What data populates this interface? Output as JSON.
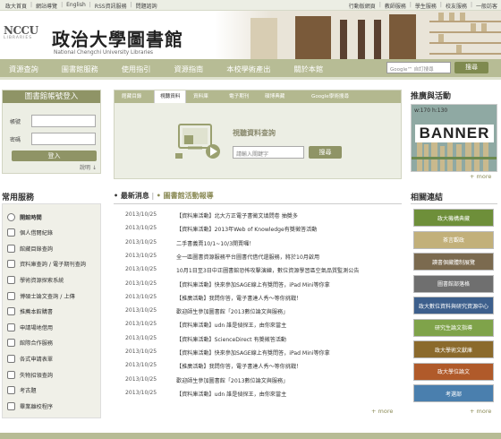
{
  "topbar": {
    "left": [
      "政大首頁",
      "網站導覽",
      "English",
      "RSS資訊服務",
      "問題諮詢"
    ],
    "right": [
      "行動版網頁",
      "教師服務",
      "學生服務",
      "校友服務",
      "一般訪客"
    ]
  },
  "header": {
    "logo_text": "NCCU",
    "logo_sub": "LIBRARIES",
    "title_zh": "政治大學圖書館",
    "title_en": "National Chengchi University Libraries"
  },
  "nav": {
    "items": [
      "資源查詢",
      "圖書館服務",
      "使用指引",
      "資源指南",
      "本校學術產出",
      "關於本館"
    ],
    "search_placeholder": "Google™ 自訂搜尋",
    "search_button": "搜尋"
  },
  "login": {
    "title": "圖書館帳號登入",
    "account_label": "帳號",
    "password_label": "密碼",
    "submit_label": "登入",
    "help_label": "說明"
  },
  "services": {
    "title": "常用服務",
    "items": [
      "開館時間",
      "個人借閱紀錄",
      "館藏目錄查詢",
      "資料庫查詢 / 電子期刊查詢",
      "學術資源探索系統",
      "博碩士論文查詢 / 上傳",
      "推薦本館購書",
      "申請場地借用",
      "館際合作服務",
      "各式申請表單",
      "失物招領查詢",
      "考古題",
      "畢業離校程序"
    ]
  },
  "search_tabs": {
    "tabs": [
      "館藏目錄",
      "視聽資料",
      "資料庫",
      "電子期刊",
      "碩博典藏",
      "Google學術搜尋"
    ],
    "active_index": 1,
    "panel_title": "視聽資料查詢",
    "input_placeholder": "請輸入關鍵字",
    "button_label": "搜尋"
  },
  "news": {
    "tab_latest": "最新消息",
    "tab_events": "圖書館活動報導",
    "items": [
      {
        "date": "2013/10/25",
        "title": "【資料庫活動】北大方正電子書徵文填問卷 抽獎多"
      },
      {
        "date": "2013/10/25",
        "title": "【資料庫活動】2013年Web of Knowledge有獎徵答活動"
      },
      {
        "date": "2013/10/25",
        "title": "二手書義賣10/1~10/3開賣囉！"
      },
      {
        "date": "2013/10/25",
        "title": "全一區圖書資源服務平台圖書代借代還服務，將於10月啟用"
      },
      {
        "date": "2013/10/25",
        "title": "10月1日至3日中正圖書館恐怖攻擊演練，數位資源學習區空氣品質監測公告"
      },
      {
        "date": "2013/10/25",
        "title": "【資料庫活動】快來參加SAGE線上有獎問答，iPad Mini等你拿"
      },
      {
        "date": "2013/10/25",
        "title": "【推廣活動】我問你答，電子書達人秀～等你挑戰！"
      },
      {
        "date": "2013/10/25",
        "title": "歡迎師生參加圖書館「2013數位論文與服務」"
      },
      {
        "date": "2013/10/25",
        "title": "【資料庫活動】udn 誰是偵探王，由你來當主"
      },
      {
        "date": "2013/10/25",
        "title": "【資料庫活動】ScienceDirect 有獎徵答活動"
      },
      {
        "date": "2013/10/25",
        "title": "【資料庫活動】快來參加SAGE線上有獎問答，iPad Mini等你拿"
      },
      {
        "date": "2013/10/25",
        "title": "【推廣活動】我問你答，電子書達人秀～等你挑戰！"
      },
      {
        "date": "2013/10/25",
        "title": "歡迎師生參加圖書館「2013數位論文與服務」"
      },
      {
        "date": "2013/10/25",
        "title": "【資料庫活動】udn 誰是偵探王，由你來當主"
      }
    ],
    "more_label": "+ more"
  },
  "promo": {
    "title": "推廣與活動",
    "banner_size": "w:170 h:130",
    "banner_text": "BANNER",
    "more_label": "+ more"
  },
  "related": {
    "title": "相關連結",
    "links": [
      {
        "label": "政大機構典藏",
        "color": "#6e8f3a"
      },
      {
        "label": "茶言觀政",
        "color": "#c2b07a"
      },
      {
        "label": "讀書個藏體制展覽",
        "color": "#7b6a4f"
      },
      {
        "label": "圖書館部落格",
        "color": "#6f6f6f"
      },
      {
        "label": "政大數位資料與研究資源中心",
        "color": "#3d5f8c"
      },
      {
        "label": "研究生論文指導",
        "color": "#7fa34a"
      },
      {
        "label": "政大學術文獻庫",
        "color": "#8b6a2c"
      },
      {
        "label": "政大學位論文",
        "color": "#b05a2a"
      },
      {
        "label": "考選部",
        "color": "#4a7fae"
      }
    ],
    "more_label": "+ more"
  }
}
